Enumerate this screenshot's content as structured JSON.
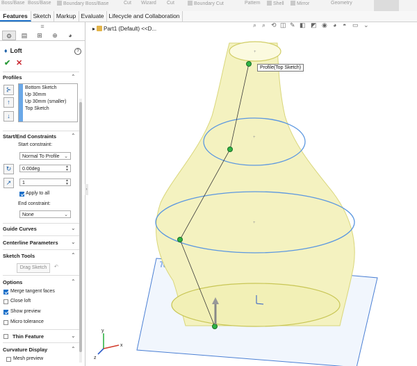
{
  "ribbon": {
    "items": [
      "Boss/Base",
      "Boss/Base",
      "Boundary Boss/Base",
      "Cut",
      "Wizard",
      "Cut",
      "Boundary Cut",
      "Pattern",
      "Shell",
      "Mirror",
      "Geometry"
    ]
  },
  "tabs": [
    "Features",
    "Sketch",
    "Markup",
    "Evaluate",
    "Lifecycle and Collaboration"
  ],
  "panel": {
    "title": "Loft",
    "help": "?",
    "profiles_header": "Profiles",
    "profiles": [
      "Bottom Sketch",
      "Up 30mm",
      "Up 30mm (smaller)",
      "Top Sketch"
    ],
    "start_end_header": "Start/End Constraints",
    "start_constraint_label": "Start constraint:",
    "start_constraint_value": "Normal To Profile",
    "angle_value": "0.00deg",
    "length_value": "1",
    "apply_to_all": "Apply to all",
    "end_constraint_label": "End constraint:",
    "end_constraint_value": "None",
    "guide_curves": "Guide Curves",
    "centerline_params": "Centerline Parameters",
    "sketch_tools": "Sketch Tools",
    "drag_sketch": "Drag Sketch",
    "options_header": "Options",
    "merge_tangent": "Merge tangent faces",
    "close_loft": "Close loft",
    "show_preview": "Show preview",
    "micro_tolerance": "Micro tolerance",
    "thin_feature": "Thin Feature",
    "curvature_display": "Curvature Display",
    "mesh_preview": "Mesh preview",
    "options_state": {
      "merge_tangent": true,
      "close_loft": false,
      "show_preview": true,
      "micro_tolerance": false,
      "apply_to_all": true,
      "thin_feature": false,
      "mesh_preview": false
    }
  },
  "viewport": {
    "tree_label": "Part1 (Default) <<D...",
    "tooltip": "Profile(Top Sketch)",
    "plane_label": "Top Plane",
    "axis": {
      "x": "x",
      "y": "y",
      "z": "z"
    }
  },
  "colors": {
    "accent": "#1a6fc8",
    "body": "#f4f2c0",
    "plane": "#4a7fd4",
    "point": "#2fb344"
  }
}
